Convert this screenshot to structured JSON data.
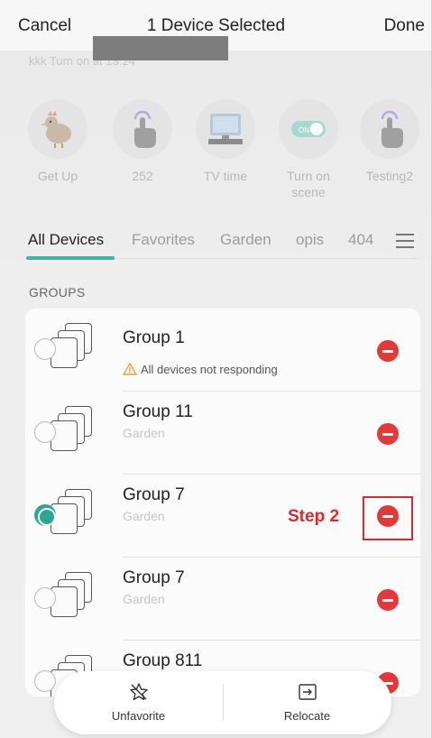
{
  "topbar": {
    "cancel_label": "Cancel",
    "title": "1 Device Selected",
    "done_label": "Done"
  },
  "scene_subtitle": "kkk Turn on at 13:24",
  "scenes": [
    {
      "label": "Get Up",
      "icon": "chicken-icon"
    },
    {
      "label": "252",
      "icon": "tap-icon"
    },
    {
      "label": "TV time",
      "icon": "tv-icon"
    },
    {
      "label": "Turn on\nscene",
      "icon": "toggle-icon"
    },
    {
      "label": "Testing2",
      "icon": "tap-icon"
    }
  ],
  "tabs": [
    {
      "label": "All Devices",
      "active": true
    },
    {
      "label": "Favorites",
      "active": false
    },
    {
      "label": "Garden",
      "active": false
    },
    {
      "label": "opis",
      "active": false
    },
    {
      "label": "404",
      "active": false
    }
  ],
  "groups_header": "GROUPS",
  "groups": [
    {
      "name": "Group 1",
      "subtitle": "All devices not responding",
      "warning": true,
      "selected": false
    },
    {
      "name": "Group 11",
      "subtitle": "Garden",
      "warning": false,
      "selected": false
    },
    {
      "name": "Group 7",
      "subtitle": "Garden",
      "warning": false,
      "selected": true
    },
    {
      "name": "Group 7",
      "subtitle": "Garden",
      "warning": false,
      "selected": false
    },
    {
      "name": "Group 811",
      "subtitle": "",
      "warning": false,
      "selected": false
    }
  ],
  "annotation": {
    "label": "Step 2",
    "color": "#d92b2b"
  },
  "actions": {
    "unfavorite_label": "Unfavorite",
    "relocate_label": "Relocate"
  },
  "colors": {
    "accent": "#3fb4a3",
    "remove": "#e23a3a",
    "warning": "#f0a030"
  }
}
